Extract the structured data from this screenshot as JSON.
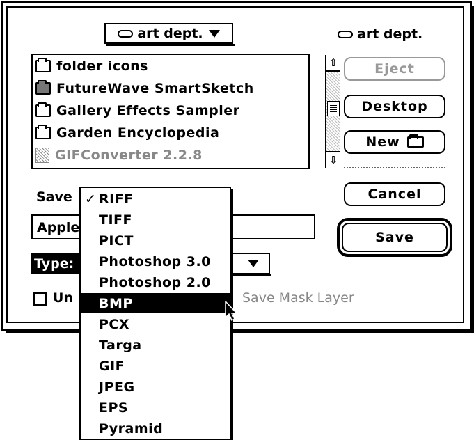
{
  "folder_popup": {
    "label": "art dept."
  },
  "disk": {
    "name": "art dept."
  },
  "file_list": [
    {
      "name": "folder icons",
      "icon": "folder-icon",
      "dimmed": false
    },
    {
      "name": "FutureWave SmartSketch",
      "icon": "folder-dark-icon",
      "dimmed": false
    },
    {
      "name": "Gallery Effects Sampler",
      "icon": "folder-icon",
      "dimmed": false
    },
    {
      "name": "Garden Encyclopedia",
      "icon": "folder-icon",
      "dimmed": false
    },
    {
      "name": "GIFConverter 2.2.8",
      "icon": "application-icon",
      "dimmed": true
    }
  ],
  "scrollbar": {
    "up": "⇧",
    "down": "⇩"
  },
  "buttons": {
    "eject": "Eject",
    "desktop": "Desktop",
    "new": "New",
    "cancel": "Cancel",
    "save": "Save"
  },
  "save_as": {
    "label": "Save",
    "filename": "Apple"
  },
  "type": {
    "label": "Type:"
  },
  "checkboxes": {
    "uncompressed": "Un",
    "save_mask": "Save Mask Layer"
  },
  "type_menu": {
    "checked": "RIFF",
    "highlighted": "BMP",
    "check_mark": "✓",
    "items": [
      "RIFF",
      "TIFF",
      "PICT",
      "Photoshop 3.0",
      "Photoshop 2.0",
      "BMP",
      "PCX",
      "Targa",
      "GIF",
      "JPEG",
      "EPS",
      "Pyramid"
    ]
  }
}
